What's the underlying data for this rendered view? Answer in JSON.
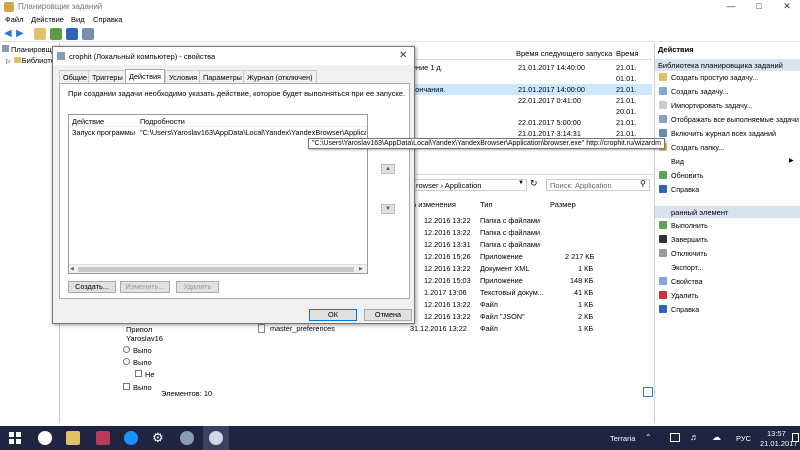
{
  "window": {
    "title": "Планировщик заданий",
    "menu": [
      "Файл",
      "Действие",
      "Вид",
      "Справка"
    ]
  },
  "tree": {
    "items": [
      "Планировщ",
      "Библиотек"
    ]
  },
  "tasks": {
    "columns": [
      "Время следующего запуска",
      "Время"
    ],
    "rows": [
      {
        "name": "ение 1 д.",
        "next_run": "21.01.2017 14:40:00",
        "last": "21.01."
      },
      {
        "name": "",
        "next_run": "",
        "last": "01.01."
      },
      {
        "name": "кончания.",
        "next_run": "21.01.2017 14:00:00",
        "last": "21.01."
      },
      {
        "name": "",
        "next_run": "22.01.2017 0:41:00",
        "last": "21.01."
      },
      {
        "name": "",
        "next_run": "",
        "last": "20.01."
      },
      {
        "name": "",
        "next_run": "22.01.2017 5:00:00",
        "last": "21.01."
      },
      {
        "name": "",
        "next_run": "21.01.2017 3:14:31",
        "last": "21.01."
      }
    ]
  },
  "actions": {
    "header": "Действия",
    "section1_title": "Библиотека планировщика заданий",
    "section1": [
      "Создать простую задачу...",
      "Создать задачу...",
      "Импортировать задачу...",
      "Отображать все выполняемые задачи",
      "Включить журнал всех заданий",
      "Создать папку...",
      "Вид",
      "Обновить",
      "Справка"
    ],
    "section2_title": "ранный элемент",
    "section2": [
      "Выполнить",
      "Завершить",
      "Отключить",
      "Экспорт...",
      "Свойства",
      "Удалить",
      "Справка"
    ]
  },
  "explorer": {
    "path_crumbs": [
      "rowser",
      "Application"
    ],
    "search_placeholder": "Поиск: Application",
    "columns": [
      "а изменения",
      "Тип",
      "Размер"
    ],
    "files": [
      {
        "name": "",
        "date": "12.2016 13:22",
        "type": "Папка с файлами",
        "size": ""
      },
      {
        "name": "",
        "date": "12.2016 13:22",
        "type": "Папка с файлами",
        "size": ""
      },
      {
        "name": "",
        "date": "12.2016 13:31",
        "type": "Папка с файлами",
        "size": ""
      },
      {
        "name": "",
        "date": "12.2016 15:26",
        "type": "Приложение",
        "size": "2 217 КБ"
      },
      {
        "name": "",
        "date": "12.2016 13:22",
        "type": "Документ XML",
        "size": "1 КБ"
      },
      {
        "name": "",
        "date": "12.2016 15:03",
        "type": "Приложение",
        "size": "148 КБ"
      },
      {
        "name": "",
        "date": "1.2017 13:06",
        "type": "Текстовый докум...",
        "size": "41 КБ"
      },
      {
        "name": "",
        "date": "12.2016 13:22",
        "type": "Файл",
        "size": "1 КБ"
      },
      {
        "name": "",
        "date": "12.2016 13:22",
        "type": "Файл \"JSON\"",
        "size": "2 КБ"
      },
      {
        "name": "master_preferences",
        "date": "31.12.2016 13:22",
        "type": "Файл",
        "size": "1 КБ"
      }
    ],
    "status": "Элементов: 10"
  },
  "left_fragments": {
    "prefix1": "Yaroslav16",
    "opt1": "Выпо",
    "opt2": "Выпо",
    "opt3": "Не",
    "opt4": "Выпо",
    "partial": "Припол"
  },
  "dialog": {
    "title": "crophit (Локальный компьютер) - свойства",
    "tabs": [
      "Общие",
      "Триггеры",
      "Действия",
      "Условия",
      "Параметры",
      "Журнал (отключен)"
    ],
    "active_tab": "Действия",
    "description": "При создании задачи необходимо указать действие, которое будет выполняться при ее запуске.",
    "list_columns": [
      "Действие",
      "Подробности"
    ],
    "list_rows": [
      {
        "action": "Запуск программы",
        "details": "\"C:\\Users\\Yaroslav163\\AppData\\Local\\Yandex\\YandexBrowser\\Application"
      }
    ],
    "buttons": {
      "create": "Создать...",
      "edit": "Изменить...",
      "delete": "Удалить"
    },
    "ok": "ОК",
    "cancel": "Отмена"
  },
  "tooltip": "\"C:\\Users\\Yaroslav163\\AppData\\Local\\Yandex\\YandexBrowser\\Application\\browser.exe\" http://crophit.ru/wizardm",
  "taskbar": {
    "app_label": "Terraria",
    "lang": "РУС",
    "time": "13:57",
    "date": "21.01.2017"
  },
  "colors": {
    "taskbar": "#1f2540",
    "selection": "#cce8ff",
    "ok_border": "#0078d7"
  }
}
